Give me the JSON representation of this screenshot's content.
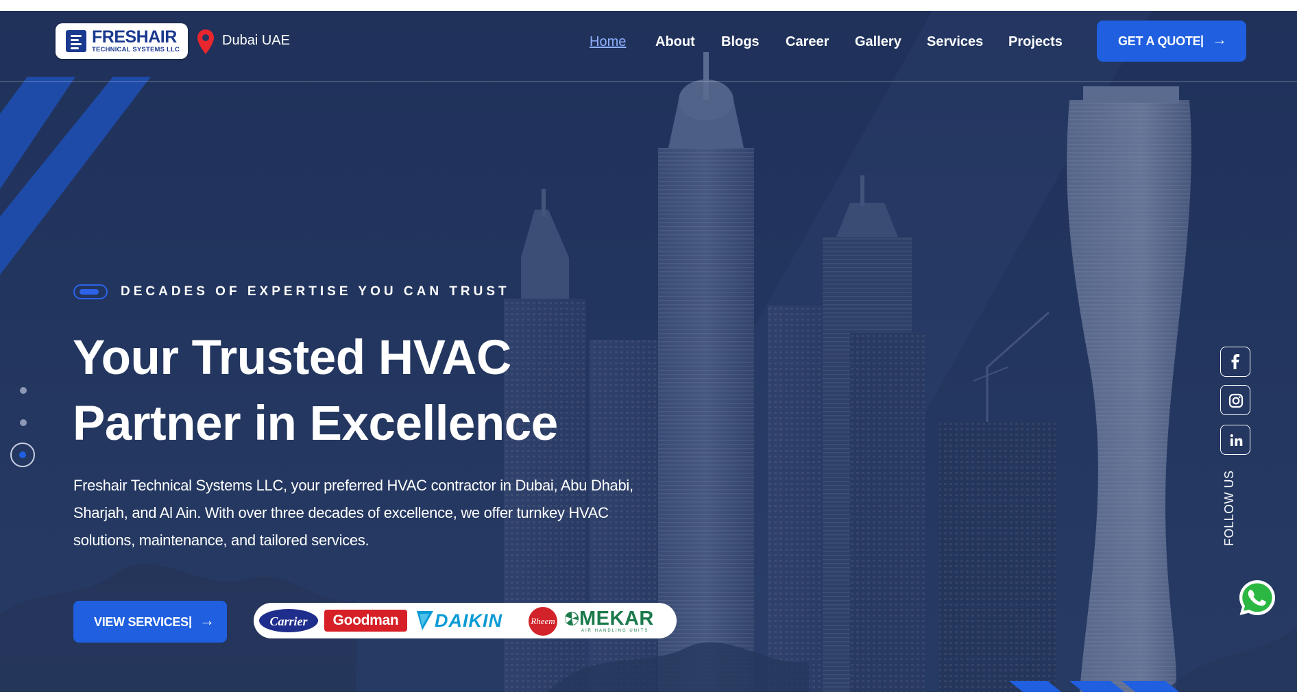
{
  "brand": {
    "name": "FRESHAIR",
    "subtitle": "TECHNICAL SYSTEMS LLC",
    "accent": "#1f5fe0",
    "logo_color": "#1a3a8f"
  },
  "location": {
    "text": "Dubai UAE",
    "icon": "location-pin-icon"
  },
  "nav": {
    "items": [
      {
        "label": "Home",
        "active": true
      },
      {
        "label": "About"
      },
      {
        "label": "Blogs"
      },
      {
        "label": "Career"
      },
      {
        "label": "Gallery"
      },
      {
        "label": "Services"
      },
      {
        "label": "Projects"
      }
    ],
    "cta": {
      "label": "GET A QUOTE",
      "separator": "|",
      "arrow": "→"
    }
  },
  "hero": {
    "tagline": "DECADES OF EXPERTISE YOU CAN TRUST",
    "headline_line1": "Your Trusted HVAC",
    "headline_line2": "Partner in Excellence",
    "intro": "Freshair Technical Systems LLC, your preferred HVAC contractor in Dubai, Abu Dhabi, Sharjah, and Al Ain. With over three decades of excellence, we offer turnkey HVAC solutions, maintenance, and tailored services.",
    "cta": {
      "label": "VIEW SERVICES",
      "separator": "|",
      "arrow": "→"
    },
    "slider": {
      "slides": 3,
      "active_index": 2
    }
  },
  "partners": [
    {
      "name": "Carrier",
      "color": "#1f2d8c"
    },
    {
      "name": "Goodman",
      "color": "#d61f26"
    },
    {
      "name": "DAIKIN",
      "color": "#0a9bd6"
    },
    {
      "name": "Rheem",
      "color": "#d2232a"
    },
    {
      "name": "MEKAR",
      "subtitle": "AIR HANDLING UNITS",
      "color": "#1b7a4b"
    }
  ],
  "social": {
    "label": "FOLLOW US",
    "links": [
      {
        "name": "facebook",
        "icon": "facebook-icon"
      },
      {
        "name": "instagram",
        "icon": "instagram-icon"
      },
      {
        "name": "linkedin",
        "icon": "linkedin-icon"
      }
    ],
    "whatsapp": {
      "icon": "whatsapp-icon",
      "color": "#ffffff"
    }
  }
}
